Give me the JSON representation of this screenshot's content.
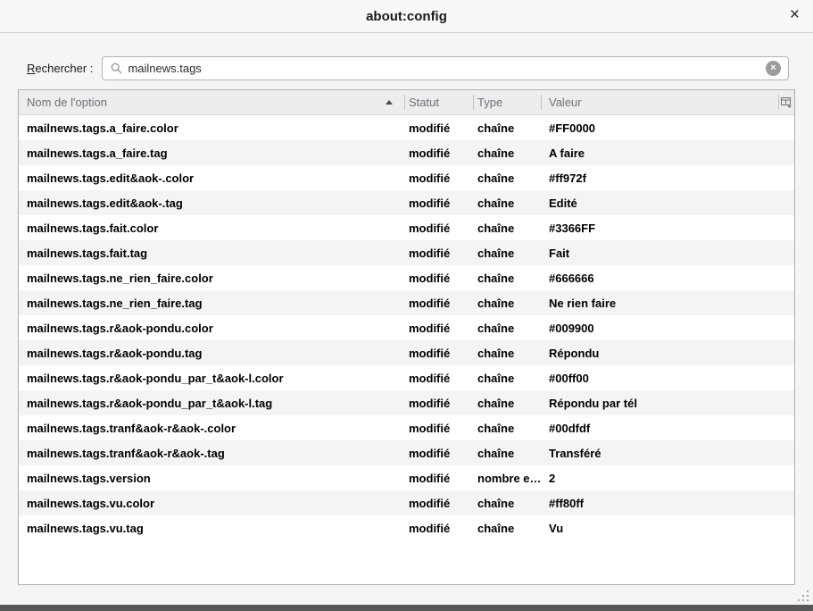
{
  "window": {
    "title": "about:config",
    "close_glyph": "×"
  },
  "search": {
    "label": "Rechercher :",
    "label_accesskey": "R",
    "label_rest": "echercher :",
    "value": "mailnews.tags",
    "clear_glyph": "×"
  },
  "table": {
    "columns": [
      {
        "label": "Nom de l'option",
        "sort": "asc"
      },
      {
        "label": "Statut"
      },
      {
        "label": "Type"
      },
      {
        "label": "Valeur"
      }
    ],
    "rows": [
      {
        "name": "mailnews.tags.a_faire.color",
        "status": "modifié",
        "type": "chaîne",
        "value": "#FF0000"
      },
      {
        "name": "mailnews.tags.a_faire.tag",
        "status": "modifié",
        "type": "chaîne",
        "value": "A faire"
      },
      {
        "name": "mailnews.tags.edit&aok-.color",
        "status": "modifié",
        "type": "chaîne",
        "value": "#ff972f"
      },
      {
        "name": "mailnews.tags.edit&aok-.tag",
        "status": "modifié",
        "type": "chaîne",
        "value": "Edité"
      },
      {
        "name": "mailnews.tags.fait.color",
        "status": "modifié",
        "type": "chaîne",
        "value": "#3366FF"
      },
      {
        "name": "mailnews.tags.fait.tag",
        "status": "modifié",
        "type": "chaîne",
        "value": "Fait"
      },
      {
        "name": "mailnews.tags.ne_rien_faire.color",
        "status": "modifié",
        "type": "chaîne",
        "value": "#666666"
      },
      {
        "name": "mailnews.tags.ne_rien_faire.tag",
        "status": "modifié",
        "type": "chaîne",
        "value": "Ne rien faire"
      },
      {
        "name": "mailnews.tags.r&aok-pondu.color",
        "status": "modifié",
        "type": "chaîne",
        "value": "#009900"
      },
      {
        "name": "mailnews.tags.r&aok-pondu.tag",
        "status": "modifié",
        "type": "chaîne",
        "value": "Répondu"
      },
      {
        "name": "mailnews.tags.r&aok-pondu_par_t&aok-l.color",
        "status": "modifié",
        "type": "chaîne",
        "value": "#00ff00"
      },
      {
        "name": "mailnews.tags.r&aok-pondu_par_t&aok-l.tag",
        "status": "modifié",
        "type": "chaîne",
        "value": "Répondu par tél"
      },
      {
        "name": "mailnews.tags.tranf&aok-r&aok-.color",
        "status": "modifié",
        "type": "chaîne",
        "value": "#00dfdf"
      },
      {
        "name": "mailnews.tags.tranf&aok-r&aok-.tag",
        "status": "modifié",
        "type": "chaîne",
        "value": "Transféré"
      },
      {
        "name": "mailnews.tags.version",
        "status": "modifié",
        "type": "nombre e…",
        "value": "2"
      },
      {
        "name": "mailnews.tags.vu.color",
        "status": "modifié",
        "type": "chaîne",
        "value": "#ff80ff"
      },
      {
        "name": "mailnews.tags.vu.tag",
        "status": "modifié",
        "type": "chaîne",
        "value": "Vu"
      }
    ]
  },
  "colors": {
    "stripe": "#f4f4f5",
    "header_bg": "#ededee",
    "border": "#b0b0b2",
    "bottom_bar": "#58585a"
  }
}
